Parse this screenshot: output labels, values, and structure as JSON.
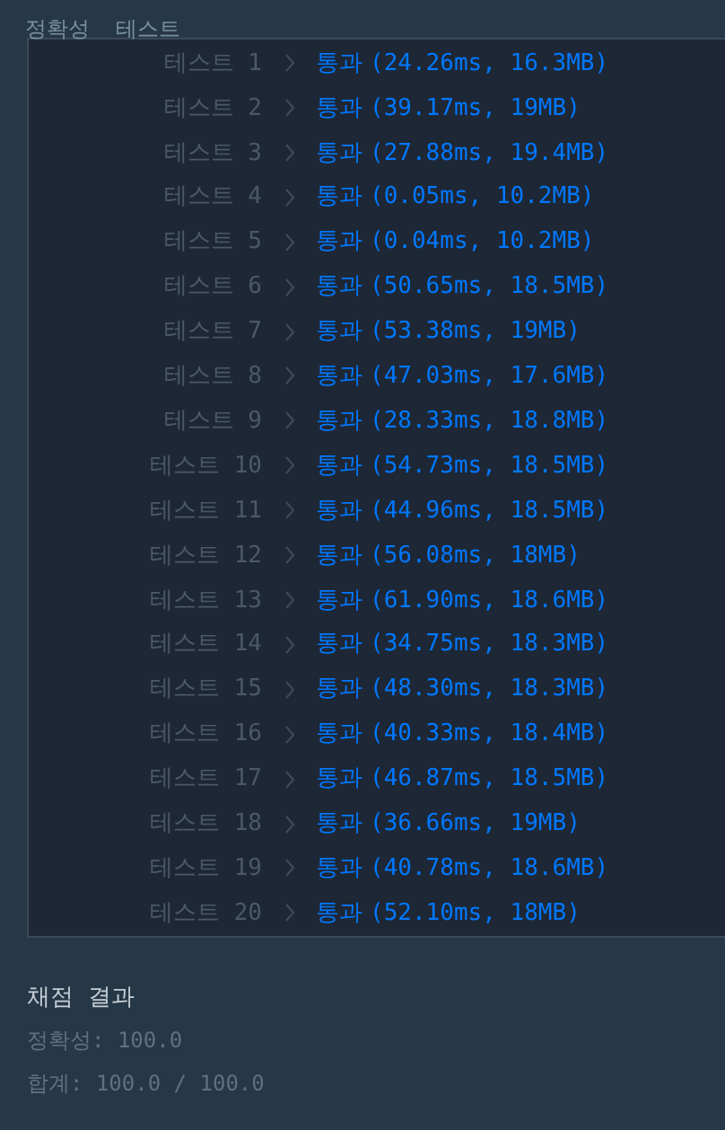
{
  "section_title": "정확성  테스트",
  "tests": [
    {
      "label": "테스트 1",
      "result": "통과",
      "detail": "(24.26ms, 16.3MB)"
    },
    {
      "label": "테스트 2",
      "result": "통과",
      "detail": "(39.17ms, 19MB)"
    },
    {
      "label": "테스트 3",
      "result": "통과",
      "detail": "(27.88ms, 19.4MB)"
    },
    {
      "label": "테스트 4",
      "result": "통과",
      "detail": "(0.05ms, 10.2MB)"
    },
    {
      "label": "테스트 5",
      "result": "통과",
      "detail": "(0.04ms, 10.2MB)"
    },
    {
      "label": "테스트 6",
      "result": "통과",
      "detail": "(50.65ms, 18.5MB)"
    },
    {
      "label": "테스트 7",
      "result": "통과",
      "detail": "(53.38ms, 19MB)"
    },
    {
      "label": "테스트 8",
      "result": "통과",
      "detail": "(47.03ms, 17.6MB)"
    },
    {
      "label": "테스트 9",
      "result": "통과",
      "detail": "(28.33ms, 18.8MB)"
    },
    {
      "label": "테스트 10",
      "result": "통과",
      "detail": "(54.73ms, 18.5MB)"
    },
    {
      "label": "테스트 11",
      "result": "통과",
      "detail": "(44.96ms, 18.5MB)"
    },
    {
      "label": "테스트 12",
      "result": "통과",
      "detail": "(56.08ms, 18MB)"
    },
    {
      "label": "테스트 13",
      "result": "통과",
      "detail": "(61.90ms, 18.6MB)"
    },
    {
      "label": "테스트 14",
      "result": "통과",
      "detail": "(34.75ms, 18.3MB)"
    },
    {
      "label": "테스트 15",
      "result": "통과",
      "detail": "(48.30ms, 18.3MB)"
    },
    {
      "label": "테스트 16",
      "result": "통과",
      "detail": "(40.33ms, 18.4MB)"
    },
    {
      "label": "테스트 17",
      "result": "통과",
      "detail": "(46.87ms, 18.5MB)"
    },
    {
      "label": "테스트 18",
      "result": "통과",
      "detail": "(36.66ms, 19MB)"
    },
    {
      "label": "테스트 19",
      "result": "통과",
      "detail": "(40.78ms, 18.6MB)"
    },
    {
      "label": "테스트 20",
      "result": "통과",
      "detail": "(52.10ms, 18MB)"
    }
  ],
  "summary": {
    "title": "채점 결과",
    "lines": [
      "정확성: 100.0",
      "합계: 100.0 / 100.0"
    ]
  }
}
